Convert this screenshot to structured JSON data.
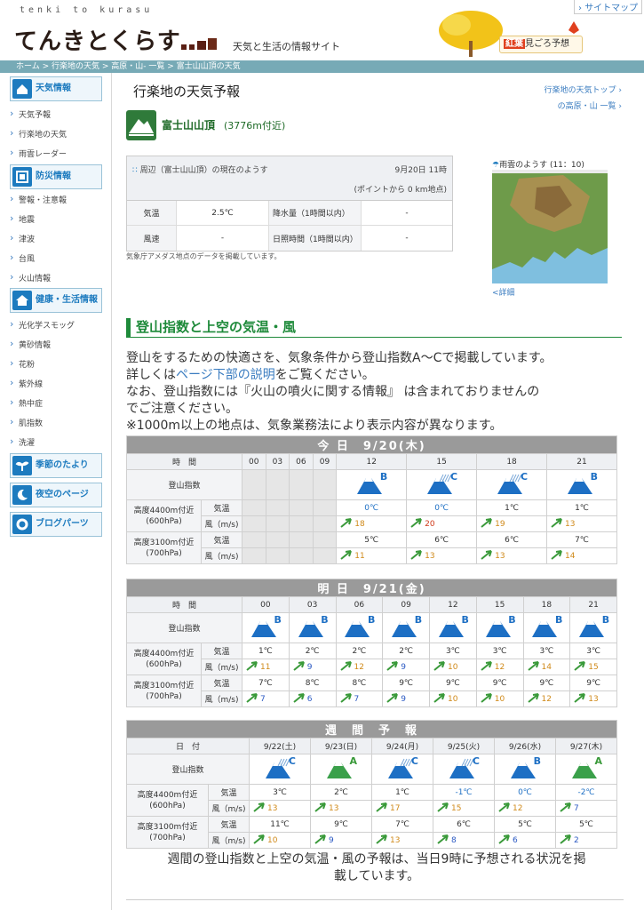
{
  "header": {
    "logo_sub": "tenki to kurasu",
    "logo_main": "てんきとくらす",
    "tagline": "天気と生活の情報サイト",
    "sitemap": "サイトマップ",
    "autumn_banner": "紅葉",
    "autumn_banner_rest": "見ごろ予想"
  },
  "breadcrumb": [
    "ホーム",
    "行楽地の天気",
    "高原・山- 一覧",
    "富士山山頂の天気"
  ],
  "sidebar": {
    "groups": [
      {
        "title": "天気情報",
        "icon": "house-icon",
        "items": [
          "天気予報",
          "行楽地の天気",
          "雨雲レーダー"
        ]
      },
      {
        "title": "防災情報",
        "icon": "warning-icon",
        "items": [
          "警報・注意報",
          "地震",
          "津波",
          "台風",
          "火山情報"
        ]
      },
      {
        "title": "健康・生活情報",
        "icon": "home-life-icon",
        "items": [
          "光化学スモッグ",
          "黄砂情報",
          "花粉",
          "紫外線",
          "熱中症",
          "肌指数",
          "洗濯"
        ]
      }
    ],
    "extras": [
      {
        "title": "季節のたより",
        "icon": "sprout-icon"
      },
      {
        "title": "夜空のページ",
        "icon": "moon-icon"
      },
      {
        "title": "ブログパーツ",
        "icon": "parts-icon"
      }
    ]
  },
  "page": {
    "title": "行楽地の天気予報",
    "link1": "行楽地の天気トップ",
    "link2": "の高原・山 一覧",
    "location": "富士山山頂",
    "altitude": "(3776m付近)"
  },
  "current": {
    "title": "周辺（富士山山頂）の現在のようす",
    "datetime": "9月20日 11時",
    "point": "(ポイントから 0 km地点)",
    "rows": [
      {
        "l1": "気温",
        "v1": "2.5℃",
        "l2": "降水量（1時間以内）",
        "v2": "-"
      },
      {
        "l1": "風速",
        "v1": "-",
        "l2": "日照時間（1時間以内）",
        "v2": "-"
      }
    ],
    "note": "気象庁アメダス地点のデータを掲載しています。"
  },
  "radar": {
    "title": "雨雲のようす (11：10)",
    "more": "<詳細"
  },
  "section": {
    "title": "登山指数と上空の気温・風"
  },
  "desc": {
    "l1": "登山をするための快適さを、気象条件から登山指数A〜Cで掲載しています。",
    "l2a": "詳しくは",
    "l2link": "ページ下部の説明",
    "l2b": "をご覧ください。",
    "l3": "なお、登山指数には『火山の噴火に関する情報』 は含まれておりませんの",
    "l4": "でご注意ください。",
    "l5": "※1000m以上の地点は、気象業務法により表示内容が異なります。"
  },
  "labels": {
    "time": "時　間",
    "date": "日　付",
    "index": "登山指数",
    "alt1a": "高度4400m付近",
    "alt1b": "(600hPa)",
    "alt2a": "高度3100m付近",
    "alt2b": "(700hPa)",
    "temp": "気温",
    "wind": "風（m/s)"
  },
  "today": {
    "caption": "今 日　9/20(木)",
    "hours": [
      "00",
      "03",
      "06",
      "09",
      "12",
      "15",
      "18",
      "21"
    ],
    "grades": [
      "",
      "",
      "",
      "",
      "B",
      "C",
      "C",
      "B"
    ],
    "t1": [
      "",
      "",
      "",
      "",
      "0℃",
      "0℃",
      "1℃",
      "1℃"
    ],
    "w1": [
      "",
      "",
      "",
      "",
      "18",
      "20",
      "19",
      "13"
    ],
    "t2": [
      "",
      "",
      "",
      "",
      "5℃",
      "6℃",
      "6℃",
      "7℃"
    ],
    "w2": [
      "",
      "",
      "",
      "",
      "11",
      "13",
      "13",
      "14"
    ]
  },
  "tomorrow": {
    "caption": "明 日　9/21(金)",
    "hours": [
      "00",
      "03",
      "06",
      "09",
      "12",
      "15",
      "18",
      "21"
    ],
    "grades": [
      "B",
      "B",
      "B",
      "B",
      "B",
      "B",
      "B",
      "B"
    ],
    "t1": [
      "1℃",
      "2℃",
      "2℃",
      "2℃",
      "3℃",
      "3℃",
      "3℃",
      "3℃"
    ],
    "w1": [
      "11",
      "9",
      "12",
      "9",
      "10",
      "12",
      "14",
      "15"
    ],
    "t2": [
      "7℃",
      "8℃",
      "8℃",
      "9℃",
      "9℃",
      "9℃",
      "9℃",
      "9℃"
    ],
    "w2": [
      "7",
      "6",
      "7",
      "9",
      "10",
      "10",
      "12",
      "13"
    ]
  },
  "weekly": {
    "caption": "週　間　予　報",
    "dates": [
      "9/22(土)",
      "9/23(日)",
      "9/24(月)",
      "9/25(火)",
      "9/26(水)",
      "9/27(木)"
    ],
    "grades": [
      "C",
      "A",
      "C",
      "C",
      "B",
      "A"
    ],
    "t1": [
      "3℃",
      "2℃",
      "1℃",
      "-1℃",
      "0℃",
      "-2℃"
    ],
    "w1": [
      "13",
      "13",
      "17",
      "15",
      "12",
      "7"
    ],
    "t2": [
      "11℃",
      "9℃",
      "7℃",
      "6℃",
      "5℃",
      "5℃"
    ],
    "w2": [
      "10",
      "9",
      "13",
      "8",
      "6",
      "2"
    ]
  },
  "weekly_note": {
    "l1": "週間の登山指数と上空の気温・風の予報は、当日9時に予想される状況を掲",
    "l2": "載しています。"
  },
  "colors": {
    "accent": "#1d7bbf",
    "green": "#1e8a3a",
    "crumb": "#77aab6"
  }
}
